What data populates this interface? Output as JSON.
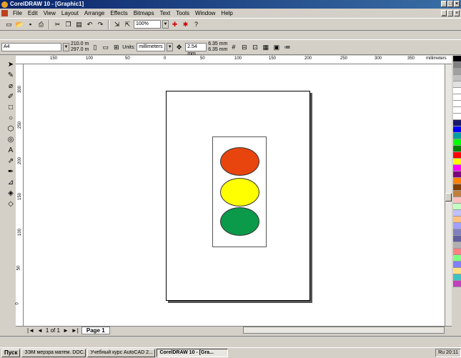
{
  "window": {
    "title": "CorelDRAW 10 - [Graphic1]"
  },
  "menu": [
    "File",
    "Edit",
    "View",
    "Layout",
    "Arrange",
    "Effects",
    "Bitmaps",
    "Text",
    "Tools",
    "Window",
    "Help"
  ],
  "toolbar": {
    "zoom": "100%"
  },
  "property_bar": {
    "paper": "A4",
    "width": "210.0 m",
    "height": "297.0 m",
    "units_label": "Units:",
    "units": "millimeters",
    "nudge": "2.54 mm",
    "dup_x": "6.35 mm",
    "dup_y": "6.35 mm"
  },
  "ruler": {
    "h_ticks": [
      "150",
      "100",
      "50",
      "0",
      "50",
      "100",
      "150",
      "200",
      "250",
      "300",
      "350"
    ],
    "h_unit": "millimeters",
    "v_ticks": [
      "300",
      "250",
      "200",
      "150",
      "100",
      "50",
      "0"
    ]
  },
  "traffic_light": {
    "top": "#e8440e",
    "middle": "#ffff00",
    "bottom": "#0a9a4a"
  },
  "page_nav": {
    "counter": "1 of 1",
    "tab": "Page 1"
  },
  "palette": [
    "#000000",
    "#808080",
    "#a0a0a0",
    "#c0c0c0",
    "#e0e0e0",
    "#ffffff",
    "#ffffff",
    "#ffffff",
    "#ffffff",
    "#ffffff",
    "#1a1a6a",
    "#0000ff",
    "#00a0a0",
    "#00ff00",
    "#008000",
    "#ff0000",
    "#ffff00",
    "#ff00ff",
    "#800080",
    "#ff8000",
    "#804000",
    "#c08040",
    "#ffc0c0",
    "#c0ffc0",
    "#c0c0ff",
    "#ffc080",
    "#a0a0ff",
    "#8080c0",
    "#6060a0",
    "#b0b0b0",
    "#ff8080",
    "#80ff80",
    "#8080ff",
    "#ffe080",
    "#40c0c0",
    "#c040c0"
  ],
  "taskbar": {
    "start": "Пуск",
    "tasks": [
      "ЗЭМ мерзра матем. DOC...",
      "Учебный курс AutoCAD 2...",
      "CorelDRAW 10 - [Gra..."
    ],
    "lang": "Ru",
    "time": "20:11"
  }
}
